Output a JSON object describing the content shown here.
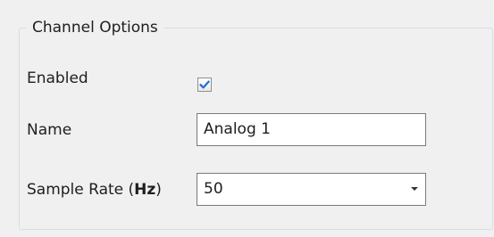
{
  "group": {
    "title": "Channel Options"
  },
  "fields": {
    "enabled": {
      "label": "Enabled",
      "checked": true
    },
    "name": {
      "label": "Name",
      "value": "Analog 1"
    },
    "sample_rate": {
      "label_prefix": "Sample Rate (",
      "label_unit": "Hz",
      "label_suffix": ")",
      "value": "50"
    }
  },
  "icons": {
    "checkbox_mark": "checkmark-icon",
    "dropdown": "chevron-down-icon"
  },
  "colors": {
    "check": "#1f6fd1",
    "border": "#7a7a7a",
    "group_border": "#d5dfe5",
    "background": "#f0f0f0"
  }
}
